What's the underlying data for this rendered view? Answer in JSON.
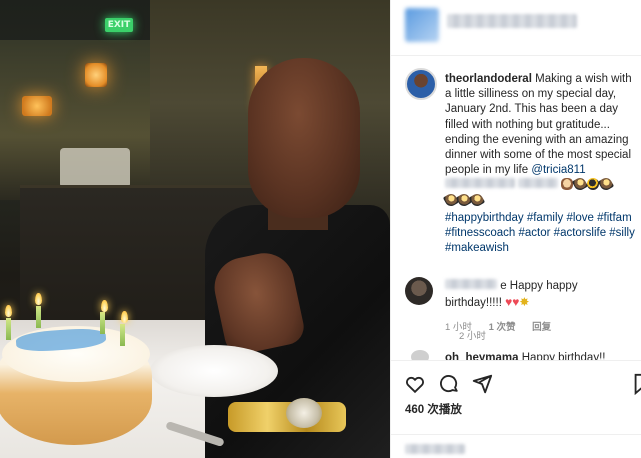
{
  "post": {
    "caption_username": "theorlandoderal",
    "caption_text": "Making a wish with a little silliness on my special day, January 2nd. This has been a day filled with nothing but gratitude... ending the evening with an amazing dinner with some of the most special people in my life",
    "mention": "@tricia811",
    "hashtags": "#happybirthday #family #love #fitfam #fitnesscoach #actor #actorslife #silly #makeawish",
    "caption_time": "2 小时",
    "views": "460 次播放"
  },
  "comments": [
    {
      "text": "e Happy happy birthday!!!!!",
      "time": "1 小时",
      "likes": "1 次赞",
      "reply": "回复"
    },
    {
      "username": "oh_heymama",
      "text": "Happy birthday!!"
    }
  ],
  "icons": {
    "like": "heart-outline-icon",
    "comment": "comment-bubble-icon",
    "share": "paper-plane-icon",
    "save": "bookmark-icon"
  },
  "colors": {
    "link": "#00376b",
    "secondary_text": "#8e8e8e",
    "heart": "#ed4956"
  }
}
